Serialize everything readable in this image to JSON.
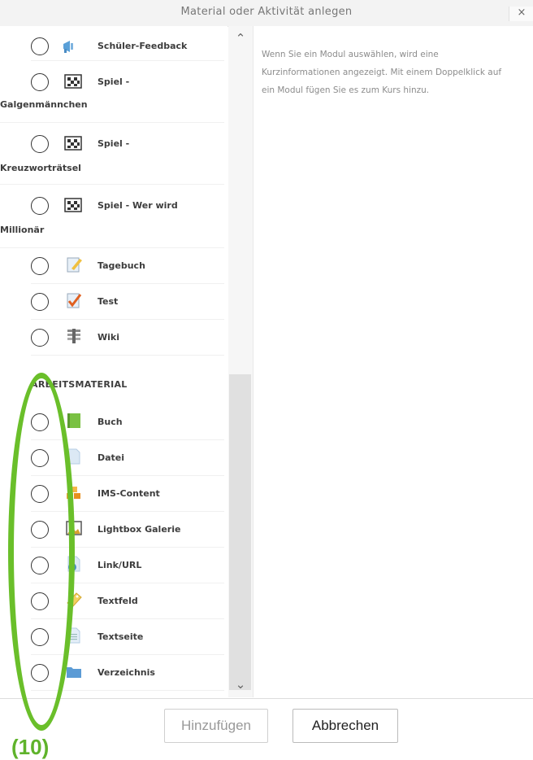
{
  "dialog": {
    "title": "Material oder Aktivität anlegen",
    "close": "×"
  },
  "activities": [
    {
      "label": "Schüler-Feedback",
      "icon": "megaphone-icon"
    },
    {
      "label": "Spiel -",
      "label2": "Galgenmännchen",
      "icon": "game-icon"
    },
    {
      "label": "Spiel -",
      "label2": "Kreuzworträtsel",
      "icon": "game-icon"
    },
    {
      "label": "Spiel - Wer wird",
      "label2": "Millionär",
      "icon": "game-icon"
    },
    {
      "label": "Tagebuch",
      "icon": "journal-icon"
    },
    {
      "label": "Test",
      "icon": "quiz-icon"
    },
    {
      "label": "Wiki",
      "icon": "wiki-icon"
    }
  ],
  "resources_section": "ARBEITSMATERIAL",
  "resources": [
    {
      "label": "Buch",
      "icon": "book-icon"
    },
    {
      "label": "Datei",
      "icon": "file-icon"
    },
    {
      "label": "IMS-Content",
      "icon": "ims-icon"
    },
    {
      "label": "Lightbox Galerie",
      "icon": "gallery-icon"
    },
    {
      "label": "Link/URL",
      "icon": "url-icon"
    },
    {
      "label": "Textfeld",
      "icon": "label-icon"
    },
    {
      "label": "Textseite",
      "icon": "page-icon"
    },
    {
      "label": "Verzeichnis",
      "icon": "folder-icon"
    }
  ],
  "info_text": "Wenn Sie ein Modul auswählen, wird eine Kurzinformationen angezeigt. Mit einem Doppelklick auf ein Modul fügen Sie es zum Kurs hinzu.",
  "buttons": {
    "add": "Hinzufügen",
    "cancel": "Abbrechen"
  },
  "scroll": {
    "up": "⌃",
    "down": "⌄"
  },
  "annotation": "(10)",
  "colors": {
    "annotation": "#6abf2a"
  }
}
